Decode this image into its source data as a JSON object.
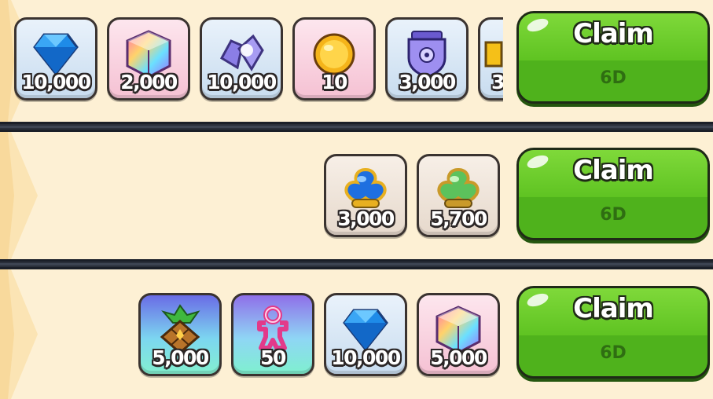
{
  "rows": [
    {
      "rewards": [
        {
          "icon": "crystal-icon",
          "qty": "10,000"
        },
        {
          "icon": "rainbow-cube-icon",
          "qty": "2,000"
        },
        {
          "icon": "soulstone-shard-icon",
          "qty": "10,000"
        },
        {
          "icon": "gold-coin-icon",
          "qty": "10"
        },
        {
          "icon": "guild-crest-icon",
          "qty": "3,000"
        },
        {
          "icon": "partial-reward-icon",
          "qty": "3"
        }
      ],
      "claim": {
        "label": "Claim",
        "timer": "6D"
      }
    },
    {
      "rewards": [
        {
          "icon": "blue-jelly-gem-icon",
          "qty": "3,000"
        },
        {
          "icon": "green-jelly-gem-icon",
          "qty": "5,700"
        }
      ],
      "claim": {
        "label": "Claim",
        "timer": "6D"
      }
    },
    {
      "rewards": [
        {
          "icon": "pineapple-sugar-icon",
          "qty": "5,000"
        },
        {
          "icon": "cookie-cutter-icon",
          "qty": "50"
        },
        {
          "icon": "crystal-icon",
          "qty": "10,000"
        },
        {
          "icon": "rainbow-cube-icon",
          "qty": "5,000"
        }
      ],
      "claim": {
        "label": "Claim",
        "timer": "6D"
      }
    }
  ],
  "colors": {
    "background": "#fdf0d4",
    "divider": "#2a2f3a",
    "claim_green": "#4fb21c",
    "claim_timer_text": "#2f6e12"
  }
}
